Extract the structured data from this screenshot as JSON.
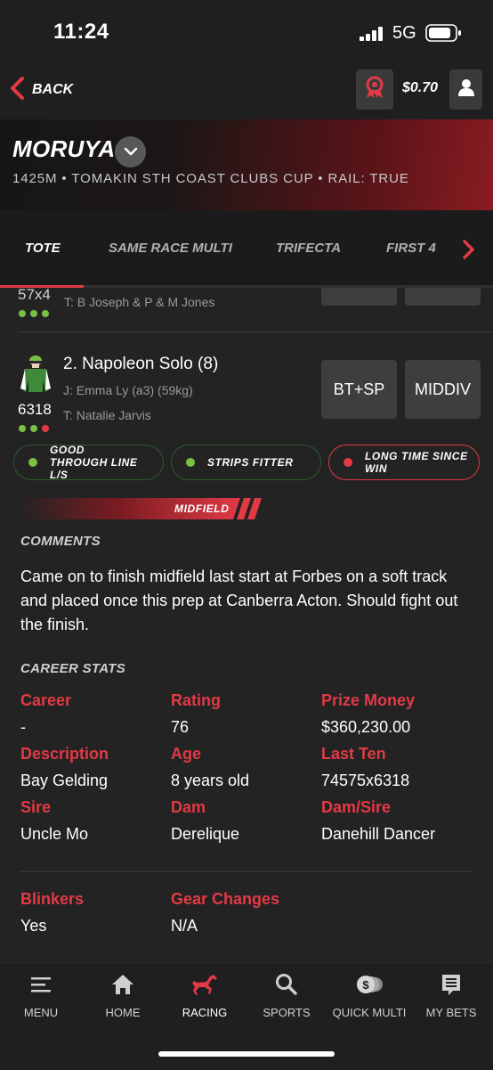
{
  "status_bar": {
    "time": "11:24",
    "network": "5G"
  },
  "top_nav": {
    "back_label": "BACK",
    "balance": "$0.70"
  },
  "race": {
    "venue": "MORUYA",
    "info": "1425M • TOMAKIN STH COAST CLUBS CUP • RAIL: TRUE"
  },
  "tabs": [
    "TOTE",
    "SAME RACE MULTI",
    "TRIFECTA",
    "FIRST 4"
  ],
  "prev_runner": {
    "form": "57x4",
    "trainer": "T: B Joseph & P & M Jones"
  },
  "runner": {
    "name": "2. Napoleon Solo (8)",
    "jockey": "J: Emma Ly (a3) (59kg)",
    "trainer": "T: Natalie Jarvis",
    "form": "6318",
    "form_dots": [
      "green",
      "green",
      "red"
    ],
    "buttons": [
      "BT+SP",
      "MIDDIV"
    ],
    "tags": [
      {
        "label": "GOOD THROUGH LINE L/S",
        "sentiment": "positive"
      },
      {
        "label": "STRIPS FITTER",
        "sentiment": "positive"
      },
      {
        "label": "LONG TIME SINCE WIN",
        "sentiment": "negative"
      }
    ],
    "position_banner": "MIDFIELD"
  },
  "comments": {
    "heading": "COMMENTS",
    "text": "Came on to finish midfield last start at Forbes on a soft track and placed once this prep at Canberra Acton. Should fight out the finish."
  },
  "career_stats": {
    "heading": "CAREER STATS",
    "rows": [
      [
        {
          "label": "Career",
          "value": "-"
        },
        {
          "label": "Rating",
          "value": "76"
        },
        {
          "label": "Prize Money",
          "value": "$360,230.00"
        }
      ],
      [
        {
          "label": "Description",
          "value": "Bay Gelding"
        },
        {
          "label": "Age",
          "value": "8 years old"
        },
        {
          "label": "Last Ten",
          "value": "74575x6318"
        }
      ],
      [
        {
          "label": "Sire",
          "value": "Uncle Mo"
        },
        {
          "label": "Dam",
          "value": "Derelique"
        },
        {
          "label": "Dam/Sire",
          "value": "Danehill Dancer"
        }
      ]
    ],
    "gear": [
      {
        "label": "Blinkers",
        "value": "Yes"
      },
      {
        "label": "Gear Changes",
        "value": "N/A"
      }
    ]
  },
  "bottom_nav": [
    {
      "label": "MENU",
      "icon": "menu-icon"
    },
    {
      "label": "HOME",
      "icon": "home-icon"
    },
    {
      "label": "RACING",
      "icon": "horse-icon",
      "active": true
    },
    {
      "label": "SPORTS",
      "icon": "search-icon"
    },
    {
      "label": "QUICK MULTI",
      "icon": "coins-icon"
    },
    {
      "label": "MY BETS",
      "icon": "betslip-icon"
    }
  ],
  "colors": {
    "accent": "#e23a45",
    "positive": "#7ac143",
    "background": "#232323"
  }
}
